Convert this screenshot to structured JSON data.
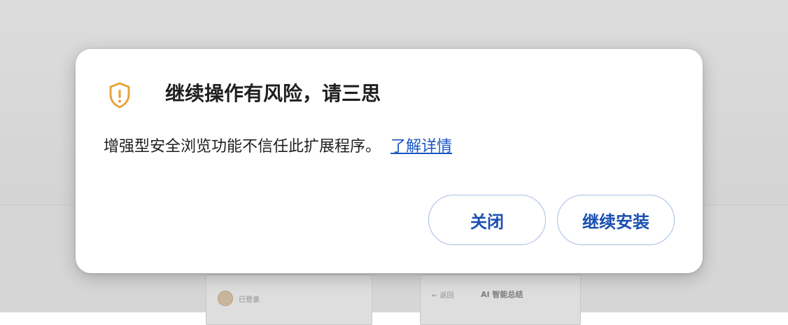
{
  "background": {
    "left_card": {
      "status": "已登录"
    },
    "right_card": {
      "back": "← 返回",
      "heading": "AI 智能总结"
    }
  },
  "dialog": {
    "icon": "warning-shield-icon",
    "title": "继续操作有风险，请三思",
    "message": "增强型安全浏览功能不信任此扩展程序。",
    "learn_more": "了解详情",
    "buttons": {
      "close": "关闭",
      "continue": "继续安装"
    }
  },
  "colors": {
    "accent": "#1a57c4",
    "warning_icon": "#e8a33c",
    "button_border": "#a9bde0"
  }
}
